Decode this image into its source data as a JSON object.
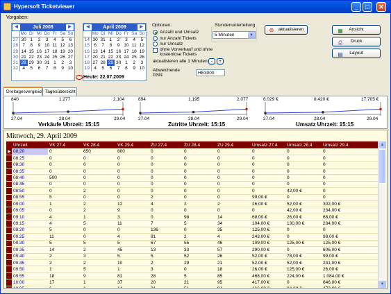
{
  "window": {
    "title": "Hypersoft Ticketviewer",
    "minimize": "_",
    "maximize": "□",
    "close": "✕"
  },
  "vorgaben_label": "Vorgaben:",
  "cal1": {
    "title": "Juli 2008",
    "days": [
      "Mo",
      "Di",
      "Mi",
      "Do",
      "Fr",
      "Sa",
      "So"
    ],
    "weeks": [
      {
        "wk": "27",
        "d": [
          "30",
          "1",
          "2",
          "3",
          "4",
          "5",
          "6"
        ]
      },
      {
        "wk": "28",
        "d": [
          "7",
          "8",
          "9",
          "10",
          "11",
          "12",
          "13"
        ]
      },
      {
        "wk": "29",
        "d": [
          "14",
          "15",
          "16",
          "17",
          "18",
          "19",
          "20"
        ]
      },
      {
        "wk": "30",
        "d": [
          "21",
          "22",
          "23",
          "24",
          "25",
          "26",
          "27"
        ]
      },
      {
        "wk": "31",
        "d": [
          "28",
          "29",
          "30",
          "31",
          "1",
          "2",
          "3"
        ]
      },
      {
        "wk": "32",
        "d": [
          "4",
          "5",
          "6",
          "7",
          "8",
          "9",
          "10"
        ]
      }
    ]
  },
  "cal2": {
    "title": "April 2009",
    "days": [
      "Mo",
      "Di",
      "Mi",
      "Do",
      "Fr",
      "Sa",
      "So"
    ],
    "weeks": [
      {
        "wk": "14",
        "d": [
          "30",
          "31",
          "1",
          "2",
          "3",
          "4",
          "5"
        ]
      },
      {
        "wk": "15",
        "d": [
          "6",
          "7",
          "8",
          "9",
          "10",
          "11",
          "12"
        ]
      },
      {
        "wk": "16",
        "d": [
          "13",
          "14",
          "15",
          "16",
          "17",
          "18",
          "19"
        ]
      },
      {
        "wk": "17",
        "d": [
          "20",
          "21",
          "22",
          "23",
          "24",
          "25",
          "26"
        ]
      },
      {
        "wk": "18",
        "d": [
          "27",
          "28",
          "29",
          "30",
          "1",
          "2",
          "3"
        ]
      },
      {
        "wk": "19",
        "d": [
          "4",
          "5",
          "6",
          "7",
          "8",
          "9",
          "10"
        ]
      }
    ]
  },
  "heute": "Heute: 22.07.2009",
  "optionen": {
    "label": "Optionen:",
    "opt1": "Anzahl und Umsatz",
    "opt2": "nur Anzahl Tickets",
    "opt3": "nur Umsatz",
    "check": "ohne Vorverkauf und ohne kostenlose Tickets",
    "refresh_label": "aktualisieren alle 1 Minuten",
    "minus": "-",
    "plus": "+",
    "dsn_label": "Abweichende DSN:",
    "dsn_value": "HE3000"
  },
  "stunden": {
    "label": "Stundenunterteilung",
    "value": "5 Minuten"
  },
  "buttons": {
    "aktualisieren": "aktualisieren",
    "ansicht": "Ansicht",
    "druck": "Druck",
    "layout": "Layout"
  },
  "tabs": [
    "Dreitagesvergleich",
    "Tagesübersicht"
  ],
  "minicharts": [
    {
      "title": "Verkäufe Uhrzeit: 15:15",
      "v": [
        "840",
        "1.277",
        "2.104"
      ],
      "d": [
        "27.04",
        "28.04",
        "29.04"
      ],
      "values": [
        840,
        1277,
        2104
      ]
    },
    {
      "title": "Zutritte Uhrzeit: 15:15",
      "v": [
        "894",
        "1.195",
        "2.077"
      ],
      "d": [
        "27.04",
        "28.04",
        "29.04"
      ],
      "values": [
        894,
        1195,
        2077
      ]
    },
    {
      "title": "Umsatz Uhrzeit: 15:15",
      "v": [
        "6.029 €",
        "8.420 €",
        "17.705 €"
      ],
      "d": [
        "27.04",
        "28.04",
        "29.04"
      ],
      "values": [
        6029,
        8420,
        17705
      ]
    }
  ],
  "date_title": "Mittwoch, 29. April 2009",
  "grid": {
    "headers": [
      "Uhrzeit",
      "VK 27.4",
      "VK 28.4",
      "VK 29.4",
      "ZU 27.4",
      "ZU 28.4",
      "ZU 29.4",
      "Umsatz 27.4",
      "Umsatz 28.4",
      "Umsatz 29.4"
    ],
    "rows": [
      [
        "08:20",
        "0",
        "650",
        "800",
        "0",
        "0",
        "0",
        "0",
        "0",
        "0"
      ],
      [
        "08:25",
        "0",
        "0",
        "0",
        "0",
        "0",
        "0",
        "0",
        "0",
        "0"
      ],
      [
        "08:30",
        "0",
        "0",
        "0",
        "0",
        "0",
        "0",
        "0",
        "0",
        "0"
      ],
      [
        "08:35",
        "0",
        "0",
        "0",
        "0",
        "0",
        "0",
        "0",
        "0",
        "0"
      ],
      [
        "08:40",
        "500",
        "0",
        "0",
        "0",
        "0",
        "0",
        "0",
        "0",
        "0"
      ],
      [
        "08:45",
        "0",
        "0",
        "0",
        "0",
        "0",
        "0",
        "0",
        "0",
        "0"
      ],
      [
        "08:50",
        "0",
        "2",
        "0",
        "0",
        "0",
        "0",
        "0",
        "42,00 €",
        "0"
      ],
      [
        "08:55",
        "5",
        "0",
        "0",
        "2",
        "0",
        "0",
        "99,00 €",
        "0",
        "0"
      ],
      [
        "09:00",
        "1",
        "2",
        "12",
        "4",
        "2",
        "2",
        "26,00 €",
        "52,00 €",
        "302,00 €"
      ],
      [
        "09:05",
        "0",
        "2",
        "9",
        "0",
        "0",
        "0",
        "0",
        "42,00 €",
        "234,00 €"
      ],
      [
        "09:10",
        "4",
        "1",
        "3",
        "0",
        "98",
        "14",
        "68,00 €",
        "26,00 €",
        "68,00 €"
      ],
      [
        "09:15",
        "4",
        "5",
        "11",
        "7",
        "5",
        "34",
        "104,00 €",
        "130,00 €",
        "234,00 €"
      ],
      [
        "09:20",
        "5",
        "0",
        "0",
        "136",
        "0",
        "35",
        "125,00 €",
        "0",
        "0"
      ],
      [
        "09:25",
        "11",
        "0",
        "4",
        "81",
        "2",
        "4",
        "243,00 €",
        "0",
        "99,00 €"
      ],
      [
        "09:30",
        "5",
        "5",
        "5",
        "67",
        "55",
        "46",
        "109,00 €",
        "125,00 €",
        "125,00 €"
      ],
      [
        "09:35",
        "14",
        "2",
        "45",
        "13",
        "33",
        "57",
        "290,00 €",
        "0",
        "606,00 €"
      ],
      [
        "09:40",
        "2",
        "3",
        "5",
        "5",
        "52",
        "26",
        "52,00 €",
        "78,00 €",
        "99,00 €"
      ],
      [
        "09:45",
        "2",
        "2",
        "10",
        "2",
        "29",
        "21",
        "52,00 €",
        "52,00 €",
        "241,00 €"
      ],
      [
        "09:50",
        "1",
        "5",
        "1",
        "3",
        "0",
        "18",
        "26,00 €",
        "125,00 €",
        "26,00 €"
      ],
      [
        "09:55",
        "18",
        "9",
        "81",
        "28",
        "5",
        "85",
        "468,00 €",
        "224,00 €",
        "1.084,00 €"
      ],
      [
        "10:00",
        "17",
        "1",
        "37",
        "20",
        "21",
        "95",
        "417,00 €",
        "0",
        "646,00 €"
      ],
      [
        "10:05",
        "6",
        "1",
        "14",
        "21",
        "51",
        "94",
        "166,00 €",
        "94,00 €",
        "472,00 €"
      ]
    ]
  },
  "scroll": {
    "up": "▲",
    "down": "▼"
  }
}
